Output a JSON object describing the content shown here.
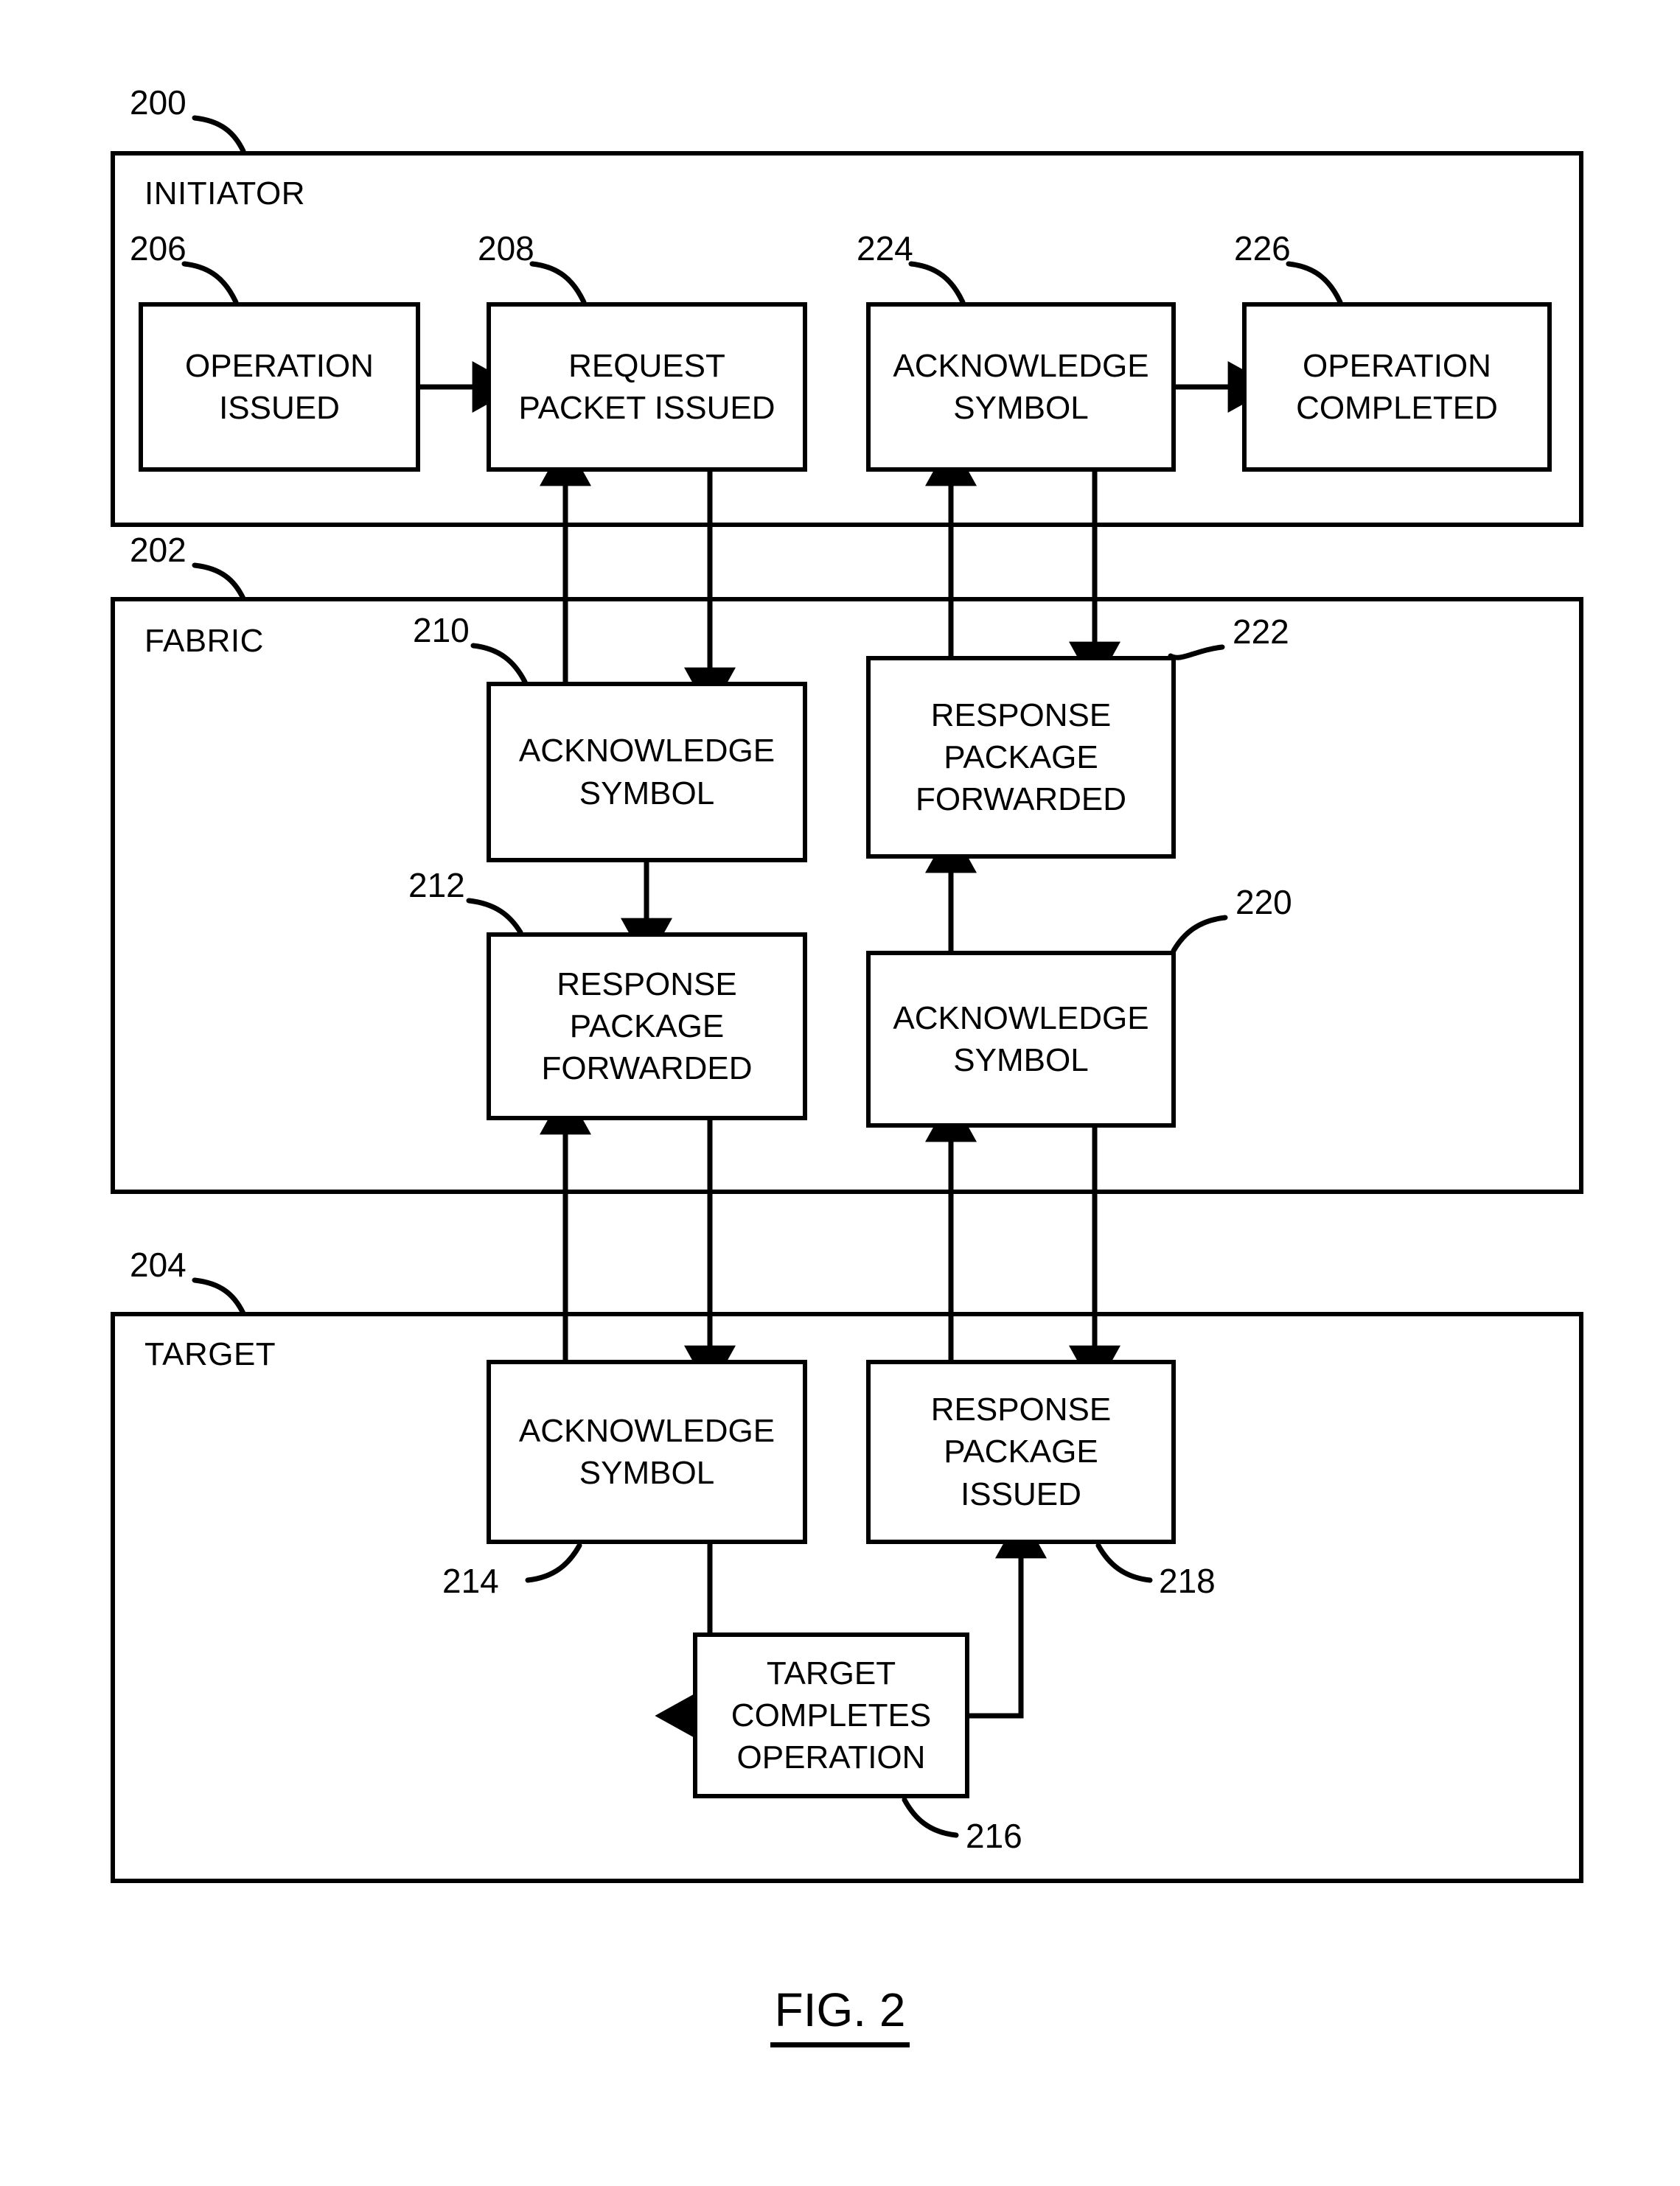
{
  "figure": {
    "caption": "FIG. 2"
  },
  "containers": [
    {
      "id": "200",
      "label": "INITIATOR",
      "ref": "200"
    },
    {
      "id": "202",
      "label": "FABRIC",
      "ref": "202"
    },
    {
      "id": "204",
      "label": "TARGET",
      "ref": "204"
    }
  ],
  "nodes": [
    {
      "ref": "206",
      "label": "OPERATION\nISSUED",
      "section": "INITIATOR"
    },
    {
      "ref": "208",
      "label": "REQUEST\nPACKET ISSUED",
      "section": "INITIATOR"
    },
    {
      "ref": "224",
      "label": "ACKNOWLEDGE\nSYMBOL",
      "section": "INITIATOR"
    },
    {
      "ref": "226",
      "label": "OPERATION\nCOMPLETED",
      "section": "INITIATOR"
    },
    {
      "ref": "210",
      "label": "ACKNOWLEDGE\nSYMBOL",
      "section": "FABRIC"
    },
    {
      "ref": "222",
      "label": "RESPONSE\nPACKAGE\nFORWARDED",
      "section": "FABRIC"
    },
    {
      "ref": "212",
      "label": "RESPONSE\nPACKAGE\nFORWARDED",
      "section": "FABRIC"
    },
    {
      "ref": "220",
      "label": "ACKNOWLEDGE\nSYMBOL",
      "section": "FABRIC"
    },
    {
      "ref": "214",
      "label": "ACKNOWLEDGE\nSYMBOL",
      "section": "TARGET"
    },
    {
      "ref": "218",
      "label": "RESPONSE\nPACKAGE\nISSUED",
      "section": "TARGET"
    },
    {
      "ref": "216",
      "label": "TARGET\nCOMPLETES\nOPERATION",
      "section": "TARGET"
    }
  ],
  "colors": {
    "line": "#000000",
    "background": "#ffffff"
  }
}
